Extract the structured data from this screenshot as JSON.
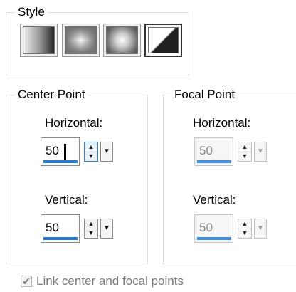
{
  "style_group": {
    "legend": "Style",
    "buttons": [
      {
        "name": "linear",
        "selected": false
      },
      {
        "name": "rectangular",
        "selected": false
      },
      {
        "name": "radial",
        "selected": false
      },
      {
        "name": "sunburst",
        "selected": true
      }
    ]
  },
  "center_point": {
    "legend": "Center Point",
    "horizontal_label": "Horizontal:",
    "horizontal_value": "50",
    "vertical_label": "Vertical:",
    "vertical_value": "50"
  },
  "focal_point": {
    "legend": "Focal Point",
    "horizontal_label": "Horizontal:",
    "horizontal_value": "50",
    "vertical_label": "Vertical:",
    "vertical_value": "50"
  },
  "link_checkbox": {
    "label": "Link center and focal points",
    "checked": true,
    "check_glyph": "✔"
  },
  "spin_glyphs": {
    "up": "▲",
    "down": "▼",
    "drop": "▼"
  },
  "colors": {
    "accent": "#1e7ee6"
  }
}
